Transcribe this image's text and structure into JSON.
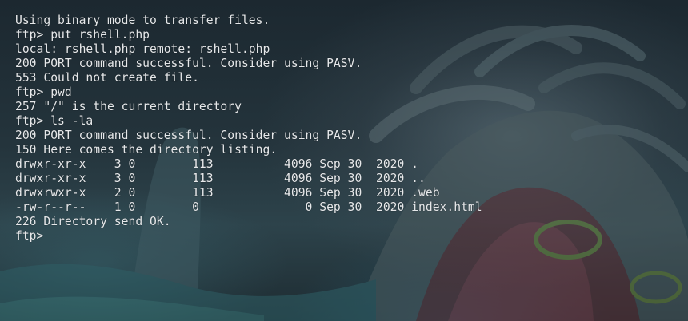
{
  "terminal": {
    "lines": [
      "Using binary mode to transfer files.",
      "ftp> put rshell.php",
      "local: rshell.php remote: rshell.php",
      "200 PORT command successful. Consider using PASV.",
      "553 Could not create file.",
      "ftp> pwd",
      "257 \"/\" is the current directory",
      "ftp> ls -la",
      "200 PORT command successful. Consider using PASV.",
      "150 Here comes the directory listing.",
      "drwxr-xr-x    3 0        113          4096 Sep 30  2020 .",
      "drwxr-xr-x    3 0        113          4096 Sep 30  2020 ..",
      "drwxrwxr-x    2 0        113          4096 Sep 30  2020 .web",
      "-rw-r--r--    1 0        0               0 Sep 30  2020 index.html",
      "226 Directory send OK.",
      "ftp>"
    ]
  },
  "colors": {
    "text": "#e6e8ea",
    "background": "#1e2b33"
  }
}
